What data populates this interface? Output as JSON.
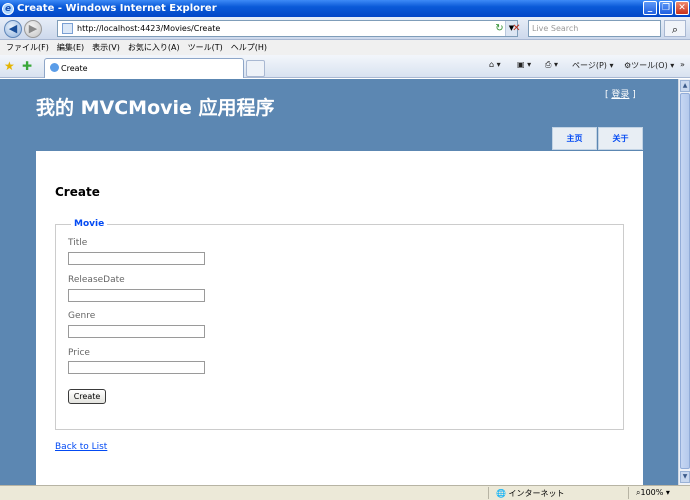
{
  "window": {
    "title": "Create - Windows Internet Explorer",
    "ie_icon": "ie-icon",
    "minimize": "_",
    "maximize": "❐",
    "close": "✕"
  },
  "address_bar": {
    "back": "◀",
    "forward": "▶",
    "url": "http://localhost:4423/Movies/Create",
    "refresh": "↻",
    "stop": "✕",
    "search_placeholder": "Live Search",
    "search_icon": "⌕"
  },
  "menu": {
    "items": [
      "ファイル(F)",
      "編集(E)",
      "表示(V)",
      "お気に入り(A)",
      "ツール(T)",
      "ヘルプ(H)"
    ]
  },
  "tabs": {
    "active_tab": "Create",
    "command_page": "ページ(P)",
    "command_tools": "ツール(O)",
    "more": "»"
  },
  "page": {
    "site_title": "我的 MVCMovie 应用程序",
    "logon_open": "[ ",
    "logon_link": "登录",
    "logon_close": " ]",
    "nav": [
      "主页",
      "关于"
    ],
    "heading": "Create",
    "legend": "Movie",
    "fields": [
      {
        "label": "Title",
        "value": ""
      },
      {
        "label": "ReleaseDate",
        "value": ""
      },
      {
        "label": "Genre",
        "value": ""
      },
      {
        "label": "Price",
        "value": ""
      }
    ],
    "create_button": "Create",
    "back_link": "Back to List"
  },
  "status_bar": {
    "zone": "インターネット",
    "zoom": "100%"
  },
  "colors": {
    "page_background": "#5c87b2",
    "link": "#034af3",
    "titlebar": "#0a5ad8"
  }
}
